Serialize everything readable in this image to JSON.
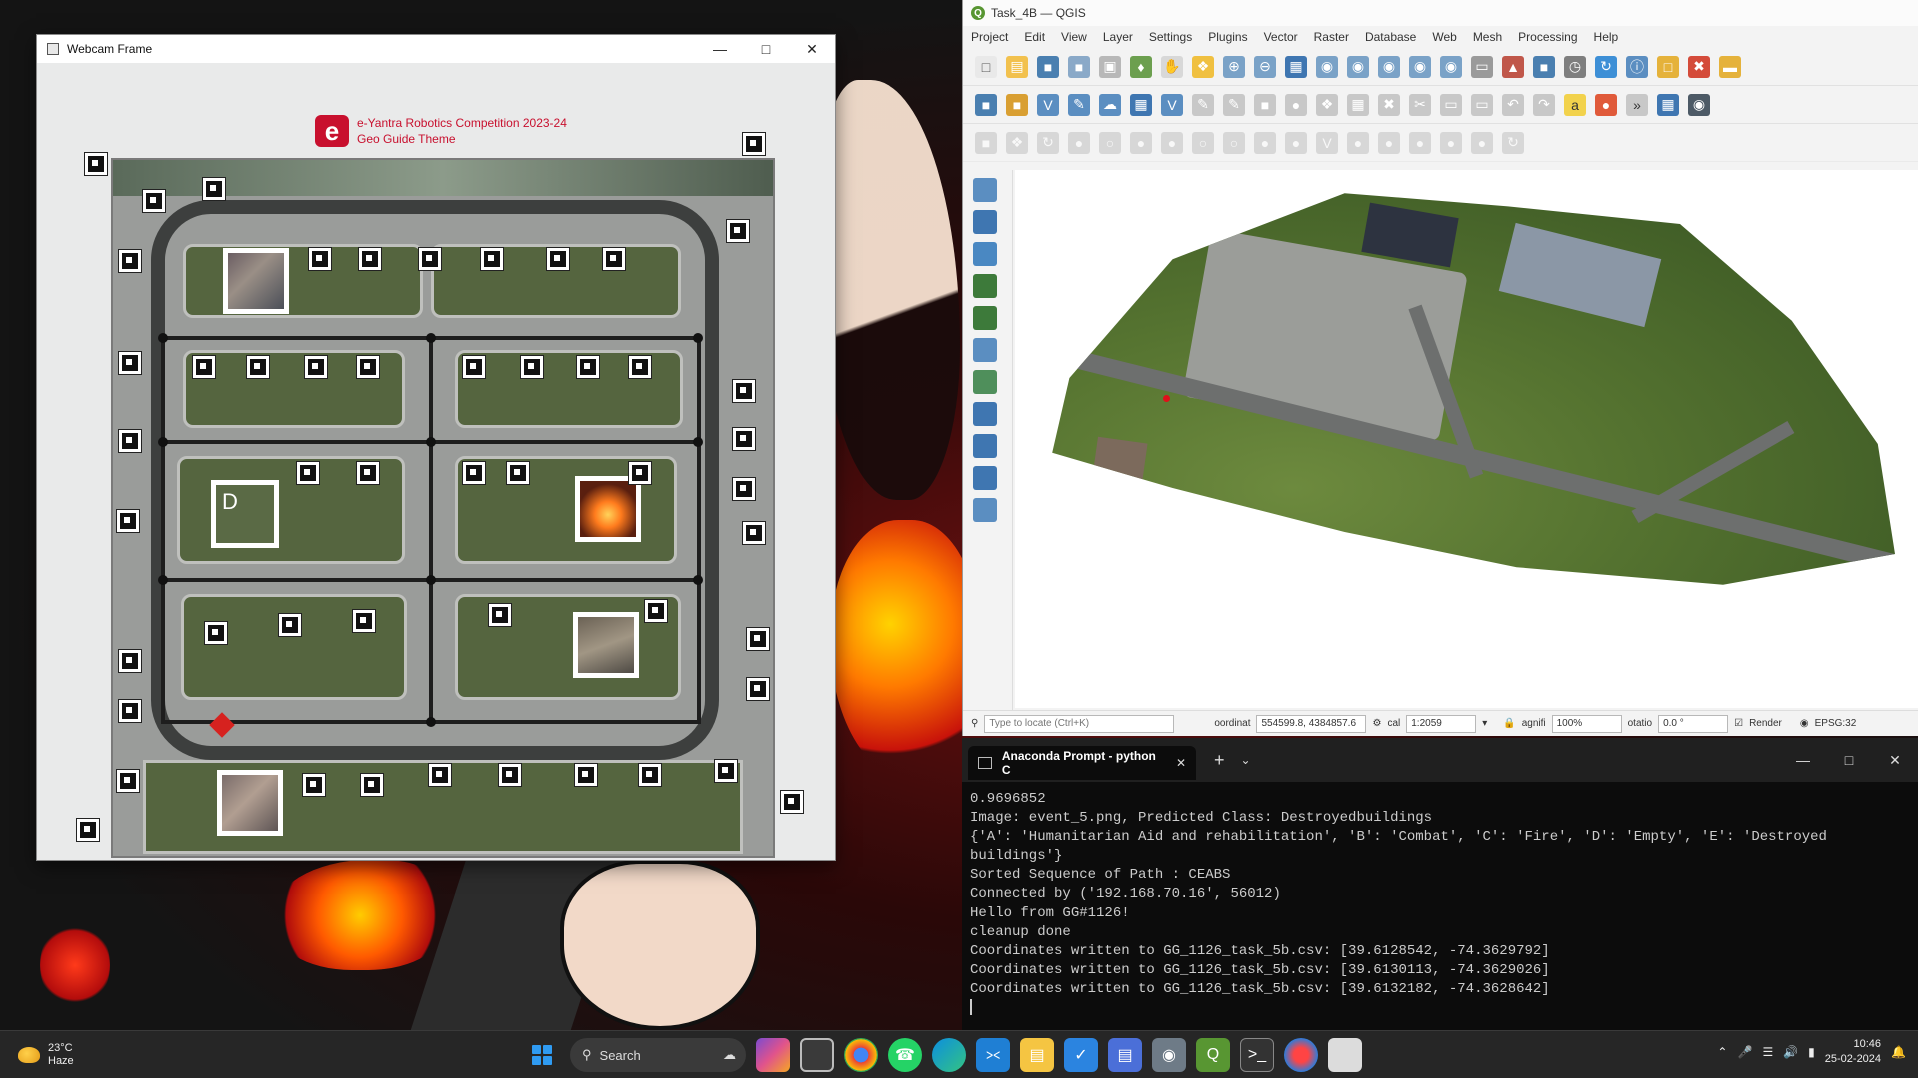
{
  "webcam": {
    "title": "Webcam Frame",
    "competition_line1": "e-Yantra Robotics Competition 2023-24",
    "competition_line2": "Geo Guide Theme",
    "logo_letter": "e",
    "empty_label": "D"
  },
  "qgis": {
    "title": "Task_4B — QGIS",
    "menu": [
      "Project",
      "Edit",
      "View",
      "Layer",
      "Settings",
      "Plugins",
      "Vector",
      "Raster",
      "Database",
      "Web",
      "Mesh",
      "Processing",
      "Help"
    ],
    "status": {
      "locate_placeholder": "Type to locate (Ctrl+K)",
      "coordinate_label": "oordinat",
      "coordinate_value": "554599.8, 4384857.6",
      "scale_label": "cal",
      "scale_value": "1:2059",
      "magnifier_label": "agnifi",
      "magnifier_value": "100%",
      "rotation_label": "otatio",
      "rotation_value": "0.0 °",
      "render_label": "Render",
      "crs_label": "EPSG:32"
    }
  },
  "terminal": {
    "tab_title": "Anaconda Prompt - python C",
    "lines": [
      "0.9696852",
      "Image: event_5.png, Predicted Class: Destroyedbuildings",
      "{'A': 'Humanitarian Aid and rehabilitation', 'B': 'Combat', 'C': 'Fire', 'D': 'Empty', 'E': 'Destroyed buildings'}",
      "Sorted Sequence of Path : CEABS",
      "Connected by ('192.168.70.16', 56012)",
      "Hello from GG#1126!",
      "cleanup done",
      "Coordinates written to GG_1126_task_5b.csv: [39.6128542, -74.3629792]",
      "Coordinates written to GG_1126_task_5b.csv: [39.6130113, -74.3629026]",
      "Coordinates written to GG_1126_task_5b.csv: [39.6132182, -74.3628642]"
    ]
  },
  "taskbar": {
    "weather_temp": "23°C",
    "weather_desc": "Haze",
    "search_label": "Search",
    "time": "10:46",
    "date": "25-02-2024"
  }
}
